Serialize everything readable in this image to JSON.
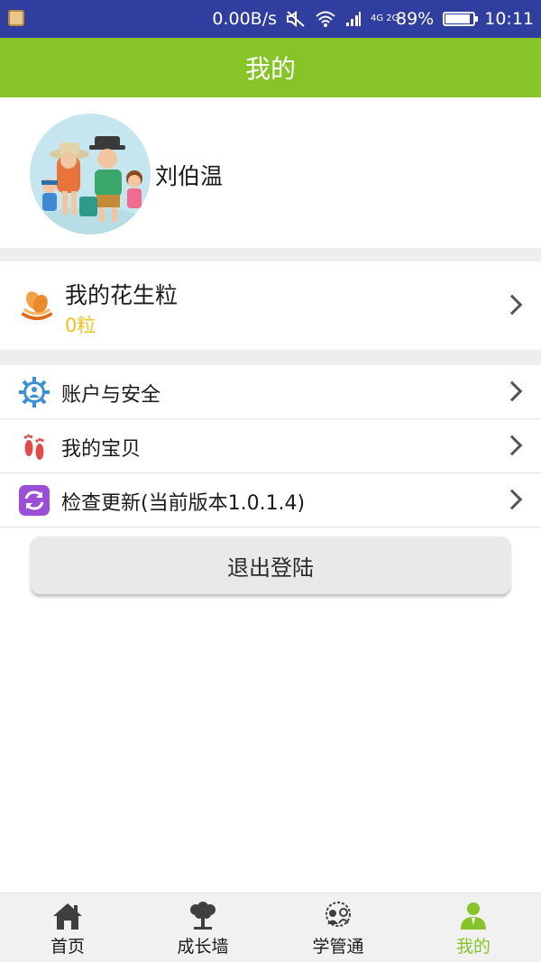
{
  "status_bar": {
    "net_speed": "0.00B/s",
    "network": "4G 2G",
    "battery": "89%",
    "battery_level": 0.89,
    "time": "10:11"
  },
  "header": {
    "title": "我的"
  },
  "profile": {
    "name": "刘伯温"
  },
  "peanuts": {
    "title": "我的花生粒",
    "count": "0粒"
  },
  "menu": {
    "items": [
      {
        "label": "账户与安全",
        "icon": "gear-person-icon"
      },
      {
        "label": "我的宝贝",
        "icon": "footprints-icon"
      },
      {
        "label": "检查更新(当前版本1.0.1.4)",
        "icon": "refresh-icon"
      }
    ]
  },
  "logout": {
    "label": "退出登陆"
  },
  "bottom_nav": {
    "items": [
      {
        "label": "首页",
        "icon": "home-icon"
      },
      {
        "label": "成长墙",
        "icon": "tree-icon"
      },
      {
        "label": "学管通",
        "icon": "chat-people-icon"
      },
      {
        "label": "我的",
        "icon": "person-icon"
      }
    ],
    "active_index": 3
  },
  "colors": {
    "status_bar": "#303e9f",
    "accent": "#86c427",
    "peanut_count": "#f2c21b",
    "divider": "#eeeeee"
  }
}
